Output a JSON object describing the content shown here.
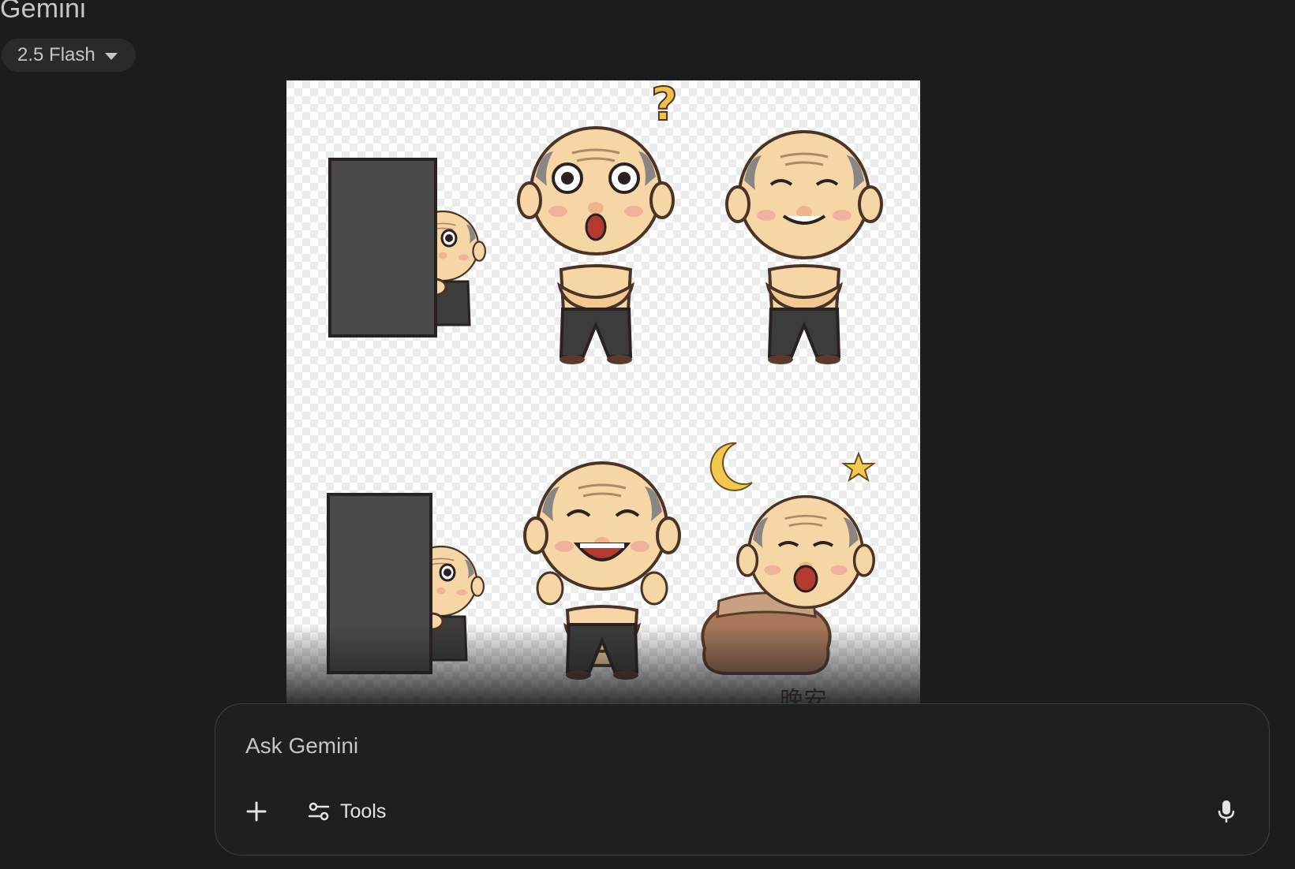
{
  "app": {
    "title": "Gemini"
  },
  "model_selector": {
    "label": "2.5 Flash",
    "icon": "caret-down-icon"
  },
  "attachment": {
    "kind": "image",
    "caption_partial": "晚安"
  },
  "composer": {
    "placeholder": "Ask Gemini",
    "value": "",
    "add_icon": "plus-icon",
    "tools_label": "Tools",
    "tools_icon": "tune-icon",
    "mic_icon": "microphone-icon"
  },
  "colors": {
    "background": "#1b1c1e",
    "pill": "#282a2c",
    "text": "#e3e3e3",
    "muted_text": "#c4c7c5",
    "panel_border": "#3c4043"
  }
}
